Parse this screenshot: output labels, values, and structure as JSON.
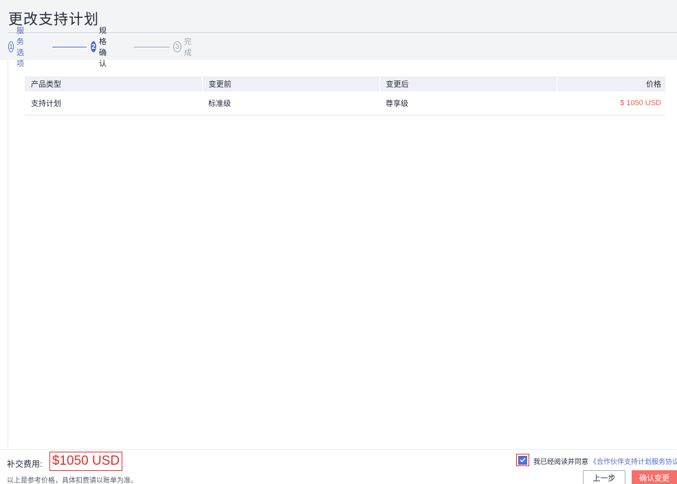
{
  "page": {
    "title": "更改支持计划"
  },
  "steps": [
    {
      "num": "1",
      "label": "服务选项"
    },
    {
      "num": "2",
      "label": "规格确认"
    },
    {
      "num": "3",
      "label": "完成"
    }
  ],
  "table": {
    "headers": [
      "产品类型",
      "变更前",
      "变更后",
      "价格"
    ],
    "rows": [
      [
        "支持计划",
        "标准级",
        "尊享级",
        "$ 1050 USD"
      ]
    ]
  },
  "footer": {
    "fee_label": "补交费用:",
    "fee_value": "$1050 USD",
    "fee_note": "以上是参考价格，具体扣费请以账单为准。",
    "agree_checked": true,
    "agree_text": "我已经阅读并同意",
    "agree_link": "《合作伙伴支持计划服务协议》",
    "prev_label": "上一步",
    "confirm_label": "确认变更"
  },
  "colors": {
    "accent": "#526ecc",
    "danger": "#e12b2b",
    "price": "#f05d52",
    "confirm_bg": "#f66f6a"
  }
}
